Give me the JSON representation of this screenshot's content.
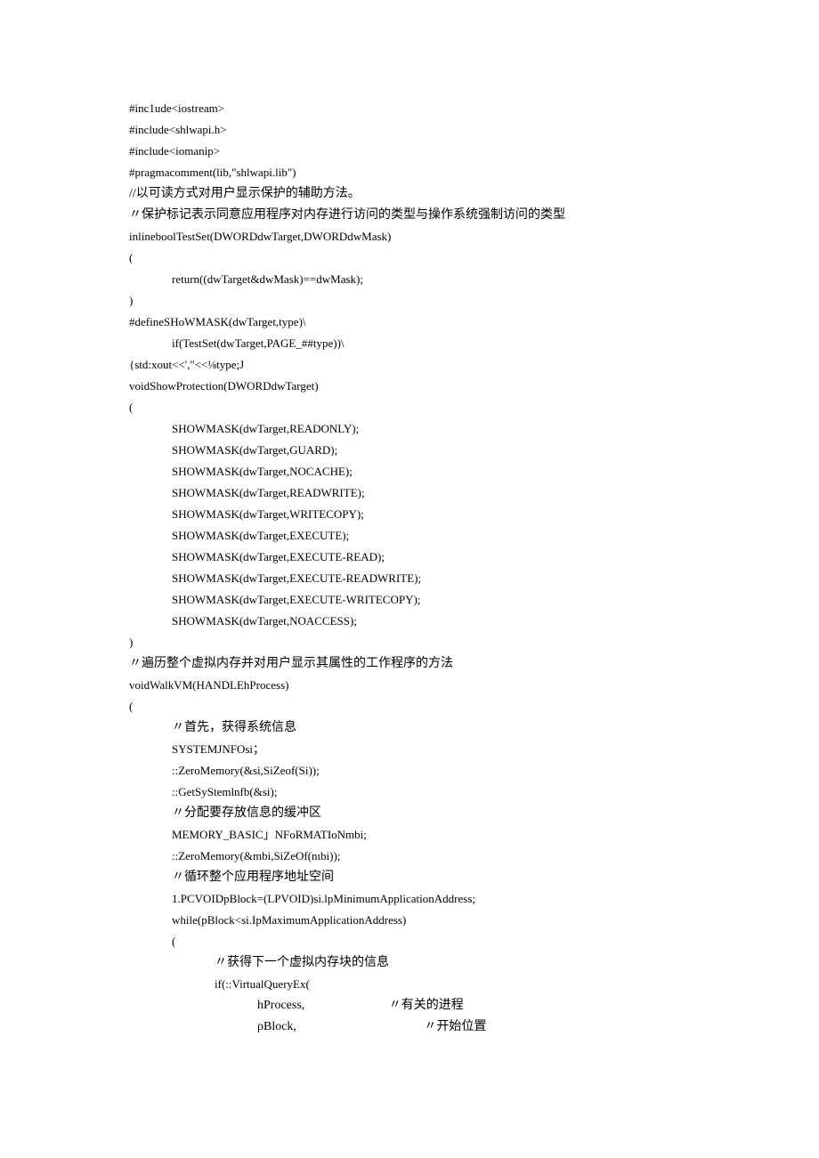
{
  "lines": [
    {
      "cls": "",
      "t": "#inc1ude<iostream>"
    },
    {
      "cls": "",
      "t": "#include<shlwapi.h>"
    },
    {
      "cls": "",
      "t": "#include<iomanip>"
    },
    {
      "cls": "",
      "t": "#pragmacomment(lib,\"shlwapi.lib\")"
    },
    {
      "cls": "cjk",
      "t": "//以可读方式对用户显示保护的辅助方法。"
    },
    {
      "cls": "cjk",
      "t": "〃保护标记表示同意应用程序对内存进行访问的类型与操作系统强制访问的类型"
    },
    {
      "cls": "",
      "t": "inlineboolTestSet(DWORDdwTarget,DWORDdwMask)"
    },
    {
      "cls": "",
      "t": "("
    },
    {
      "cls": "indent1",
      "t": "return((dwTarget&dwMask)==dwMask);"
    },
    {
      "cls": "",
      "t": ")"
    },
    {
      "cls": "",
      "t": "#defineSHoWMASK(dwTarget,type)\\"
    },
    {
      "cls": "indent1",
      "t": "if(TestSet(dwTarget,PAGE_##type))\\"
    },
    {
      "cls": "",
      "t": "{std:xout<<',\"<<⅛type;J"
    },
    {
      "cls": "",
      "t": "voidShowProtection(DWORDdwTarget)"
    },
    {
      "cls": "",
      "t": "("
    },
    {
      "cls": "indent1",
      "t": "SHOWMASK(dwTarget,READONLY);"
    },
    {
      "cls": "indent1",
      "t": "SHOWMASK(dwTarget,GUARD);"
    },
    {
      "cls": "indent1",
      "t": "SHOWMASK(dwTarget,NOCACHE);"
    },
    {
      "cls": "indent1",
      "t": "SHOWMASK(dwTarget,READWRITE);"
    },
    {
      "cls": "indent1",
      "t": "SHOWMASK(dwTarget,WRITECOPY);"
    },
    {
      "cls": "indent1",
      "t": "SHOWMASK(dwTarget,EXECUTE);"
    },
    {
      "cls": "indent1",
      "t": "SHOWMASK(dwTarget,EXECUTE-READ);"
    },
    {
      "cls": "indent1",
      "t": "SHOWMASK(dwTarget,EXECUTE-READWRITE);"
    },
    {
      "cls": "indent1",
      "t": "SHOWMASK(dwTarget,EXECUTE-WRITECOPY);"
    },
    {
      "cls": "indent1",
      "t": "SHOWMASK(dwTarget,NOACCESS);"
    },
    {
      "cls": "",
      "t": ")"
    },
    {
      "cls": "cjk",
      "t": "〃遍历整个虚拟内存并对用户显示其属性的工作程序的方法"
    },
    {
      "cls": "",
      "t": "voidWalkVM(HANDLEhProcess)"
    },
    {
      "cls": "",
      "t": "("
    },
    {
      "cls": "indent1 cjk",
      "t": "〃首先，获得系统信息"
    },
    {
      "cls": "indent1 syscall",
      "t": "SYSTEMJNFOsi；"
    },
    {
      "cls": "indent1",
      "t": "::ZeroMemory(&si,SiZeof(Si));"
    },
    {
      "cls": "indent1",
      "t": "::GetSyStemlnfb(&si);"
    },
    {
      "cls": "indent1 cjk",
      "t": "〃分配要存放信息的缓冲区"
    },
    {
      "cls": "indent1",
      "t": "MEMORY_BASIC」NFoRMATIoNmbi;"
    },
    {
      "cls": "indent1",
      "t": "::ZeroMemory(&mbi,SiZeOf(nιbi));"
    },
    {
      "cls": "indent1 cjk",
      "t": "〃循环整个应用程序地址空间"
    },
    {
      "cls": "indent1",
      "t": "1.PCVOIDpBlock=(LPVOID)si.lpMinimumApplicationAddress;"
    },
    {
      "cls": "indent1",
      "t": "while(pBlock<si.IpMaximumApplicationAddress)"
    },
    {
      "cls": "indent1",
      "t": "("
    },
    {
      "cls": "indent2 cjk",
      "t": "〃获得下一个虚拟内存块的信息"
    },
    {
      "cls": "indent2",
      "t": "if(::VirtualQueryEx("
    },
    {
      "cls": "indent3 cjk",
      "t": "hProcess,                           〃有关的进程"
    },
    {
      "cls": "indent3 cjk",
      "t": "ρBlock,                                         〃开始位置"
    }
  ]
}
